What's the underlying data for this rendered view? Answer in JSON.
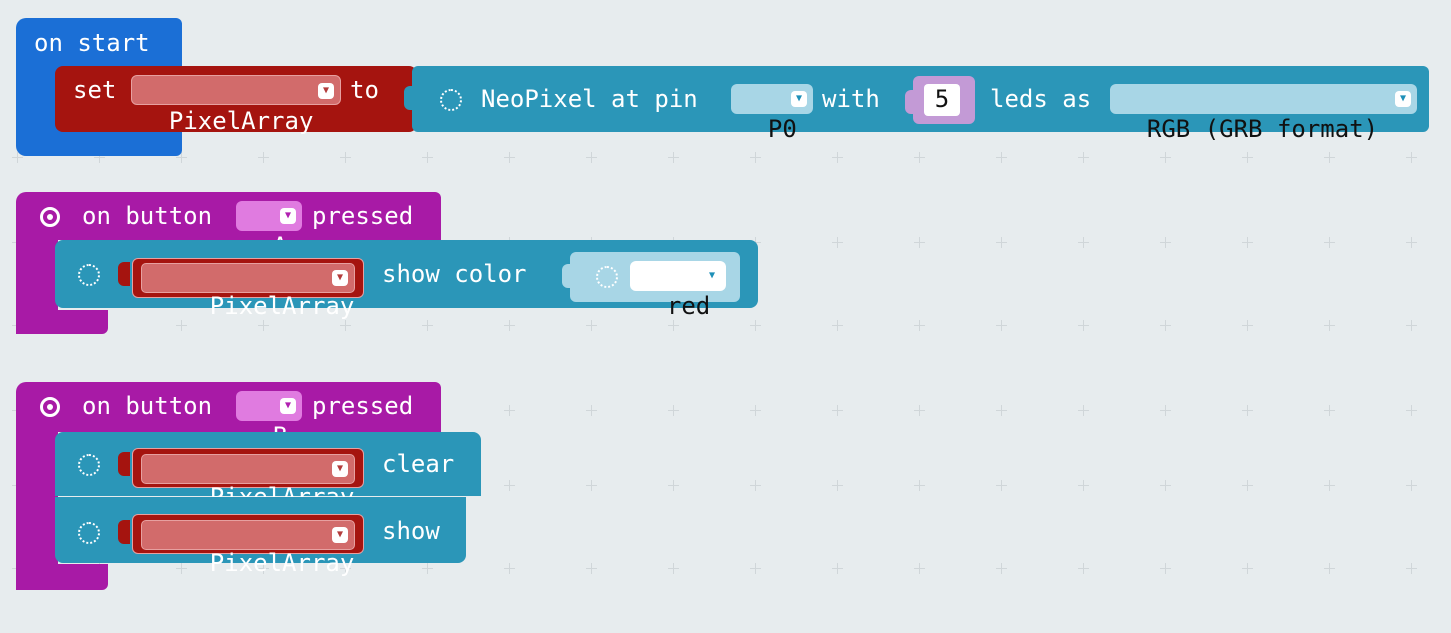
{
  "colors": {
    "background": "#e7ecee",
    "basic_blue": "#1b6fd6",
    "variable_red": "#a5140f",
    "neopixel_blue": "#2b96b8",
    "input_purple": "#a81aa6",
    "colour_light_blue": "#a8d6e6",
    "number_lilac": "#c39ad6"
  },
  "icons": [
    "loading-dots-icon",
    "target-icon",
    "dropdown-arrow-icon"
  ],
  "on_start": {
    "label": "on start",
    "set_label": "set",
    "variable": "PixelArray",
    "to_label": "to",
    "create_label": "NeoPixel at pin",
    "pin": "P0",
    "with_label": "with",
    "led_count": "5",
    "leds_as_label": "leds as",
    "mode": "RGB (GRB format)"
  },
  "button_a": {
    "on_label": "on button",
    "button": "A",
    "pressed_label": "pressed",
    "variable": "PixelArray",
    "show_color_label": "show color",
    "color": "red"
  },
  "button_b": {
    "on_label": "on button",
    "button": "B",
    "pressed_label": "pressed",
    "variable_1": "PixelArray",
    "clear_label": "clear",
    "variable_2": "PixelArray",
    "show_label": "show"
  }
}
